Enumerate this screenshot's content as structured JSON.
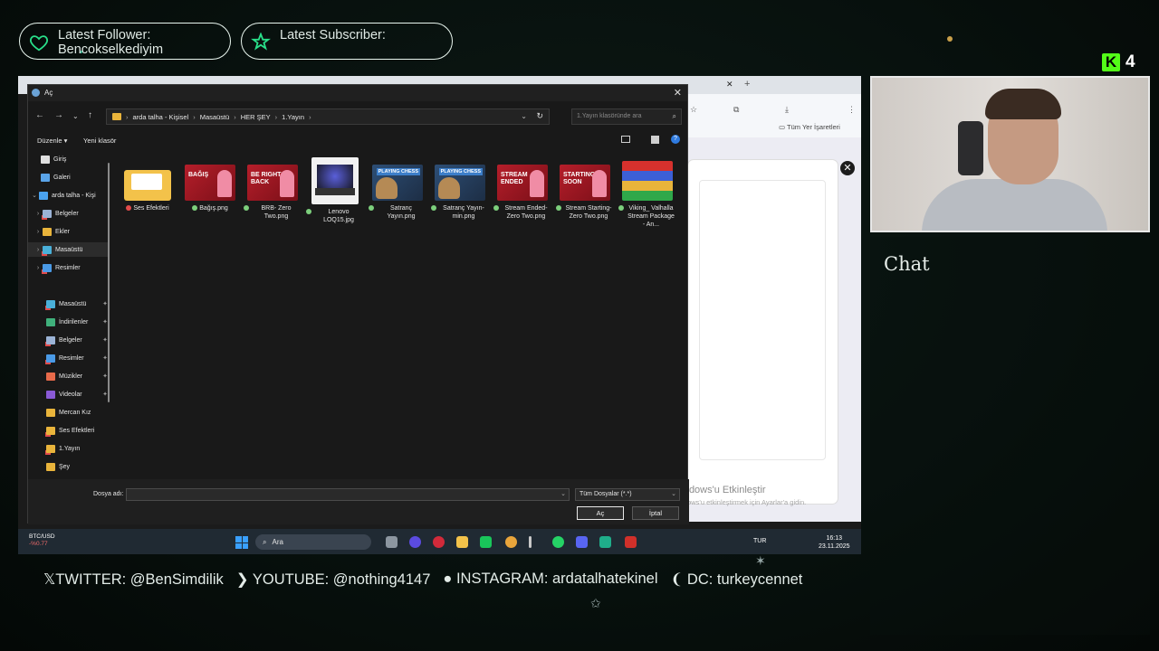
{
  "overlay": {
    "follower_label": "Latest Follower:",
    "follower_name": "Bencokselkediyim",
    "subscriber_label": "Latest Subscriber:",
    "subscriber_name": "",
    "kick_count": "4",
    "chat_title": "Chat",
    "socials": [
      "TWITTER: @BenSimdilik",
      "YOUTUBE: @nothing4147",
      "INSTAGRAM: ardatalhatekinel",
      "DC: turkeycennet"
    ],
    "accent_color": "#29e08a",
    "kick_color": "#53fc18"
  },
  "browser": {
    "bookmarks_label": "Tüm Yer İşaretleri",
    "activate_title": "Windows'u Etkinleştir",
    "activate_sub": "Windows'u etkinleştirmek için Ayarlar'a gidin."
  },
  "dialog": {
    "title": "Aç",
    "path": [
      "arda talha - Kişisel",
      "Masaüstü",
      "HER ŞEY",
      "1.Yayın"
    ],
    "search_placeholder": "1.Yayın klasöründe ara",
    "organize": "Düzenle ▾",
    "new_folder": "Yeni klasör",
    "sidebar": [
      {
        "label": "Giriş",
        "icon": "home-icon",
        "color": "#e0e0e0"
      },
      {
        "label": "Galeri",
        "icon": "gallery-icon",
        "color": "#5aa4e8"
      },
      {
        "label": "arda talha - Kişi",
        "icon": "onedrive-icon",
        "color": "#4aa3f0"
      },
      {
        "label": "Belgeler",
        "icon": "documents-icon",
        "color": "#9bb3d6"
      },
      {
        "label": "Ekler",
        "icon": "folder-icon",
        "color": "#e9b43b"
      },
      {
        "label": "Masaüstü",
        "icon": "desktop-icon",
        "color": "#4ab0d9"
      },
      {
        "label": "Resimler",
        "icon": "pictures-icon",
        "color": "#4a9ae6"
      },
      {
        "label": "Masaüstü",
        "icon": "desktop-icon",
        "color": "#4ab0d9"
      },
      {
        "label": "İndirilenler",
        "icon": "download-icon",
        "color": "#3fb07b"
      },
      {
        "label": "Belgeler",
        "icon": "documents-icon",
        "color": "#9bb3d6"
      },
      {
        "label": "Resimler",
        "icon": "pictures-icon",
        "color": "#4a9ae6"
      },
      {
        "label": "Müzikler",
        "icon": "music-icon",
        "color": "#e86a4a"
      },
      {
        "label": "Videolar",
        "icon": "videos-icon",
        "color": "#8a5ad6"
      },
      {
        "label": "Mercan Kız",
        "icon": "folder-icon",
        "color": "#e9b43b"
      },
      {
        "label": "Ses Efektleri",
        "icon": "folder-icon",
        "color": "#e9b43b"
      },
      {
        "label": "1.Yayın",
        "icon": "folder-icon",
        "color": "#e9b43b"
      },
      {
        "label": "Şey",
        "icon": "folder-icon",
        "color": "#e9b43b"
      }
    ],
    "files": [
      {
        "name": "Ses Efektleri",
        "kind": "folder",
        "thumb_text": ""
      },
      {
        "name": "Bağış.png",
        "kind": "red",
        "thumb_text": "BAĞIŞ"
      },
      {
        "name": "BRB- Zero Two.png",
        "kind": "red",
        "thumb_text": "BE RIGHT BACK"
      },
      {
        "name": "Lenovo LOQ15.jpg",
        "kind": "laptop",
        "thumb_text": ""
      },
      {
        "name": "Satranç Yayın.png",
        "kind": "chess",
        "thumb_text": "PLAYING CHESS"
      },
      {
        "name": "Satranç Yayın-min.png",
        "kind": "chess",
        "thumb_text": "PLAYING CHESS"
      },
      {
        "name": "Stream Ended-Zero Two.png",
        "kind": "red",
        "thumb_text": "STREAM ENDED"
      },
      {
        "name": "Stream Starting-Zero Two.png",
        "kind": "red",
        "thumb_text": "STARTING SOON"
      },
      {
        "name": "Viking_ Valhalla Stream Package - An...",
        "kind": "rar",
        "thumb_text": ""
      }
    ],
    "filename_label": "Dosya adı:",
    "filename_value": "",
    "filetype": "Tüm Dosyalar (*.*)",
    "open_button": "Aç",
    "cancel_button": "İptal"
  },
  "taskbar": {
    "ticker": "BTC/USD",
    "ticker_change": "-%0.77",
    "search": "Ara",
    "lang": "TUR",
    "time": "16:13",
    "date": "23.11.2025"
  }
}
